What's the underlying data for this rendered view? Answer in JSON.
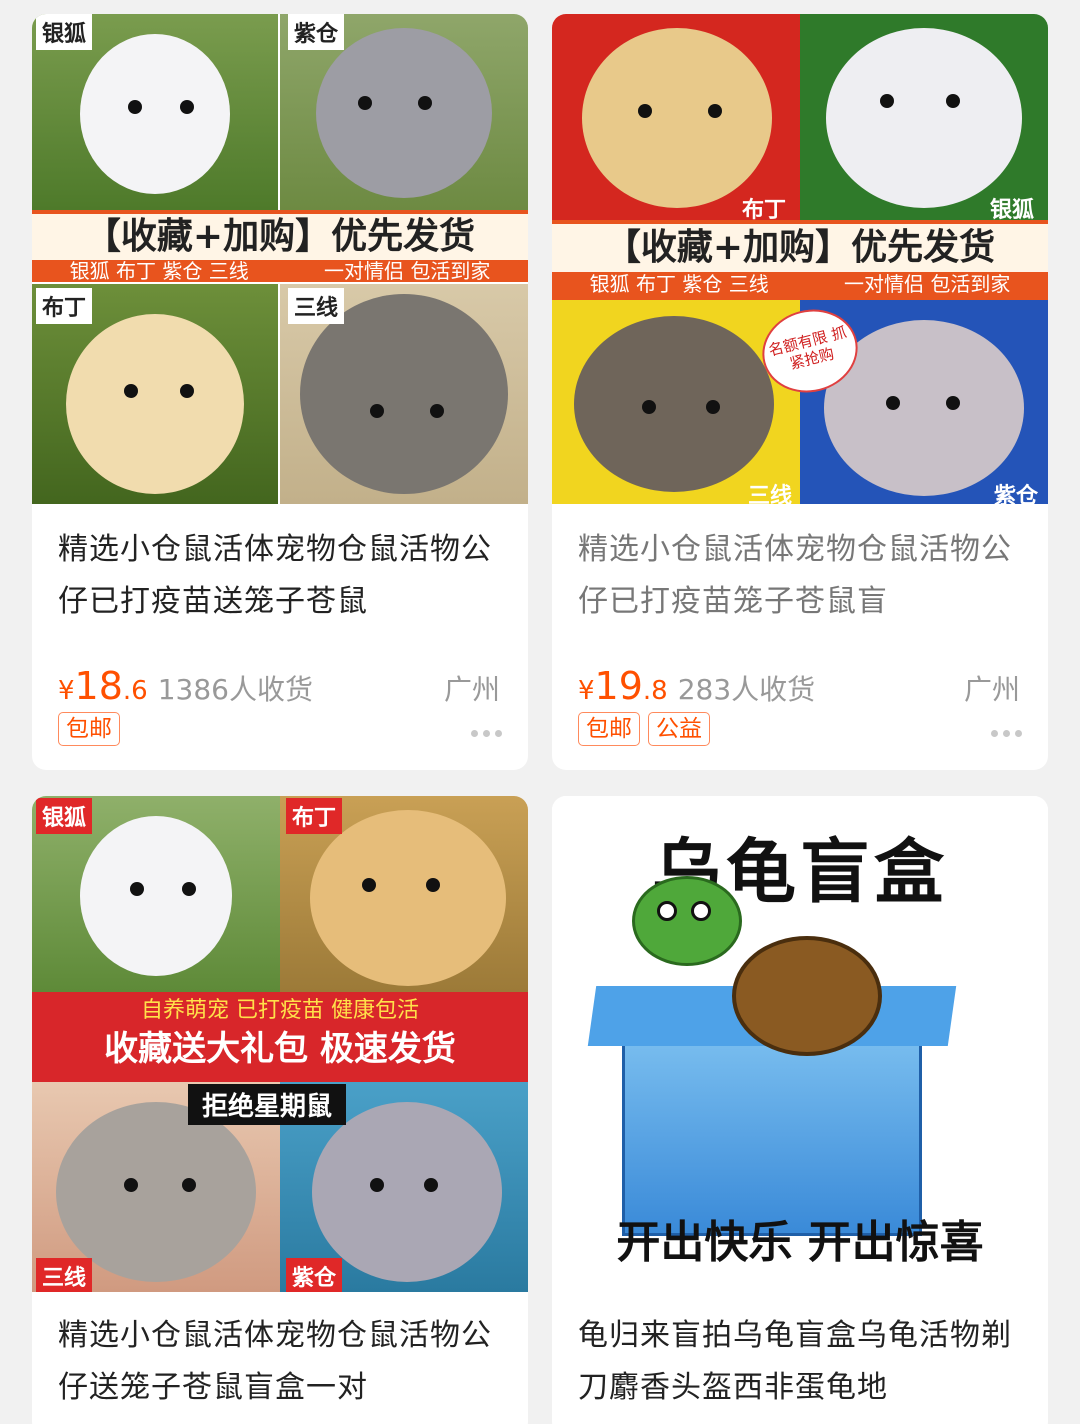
{
  "products": [
    {
      "image_labels": [
        "银狐",
        "紫仓",
        "布丁",
        "三线"
      ],
      "banner_main": "【收藏+加购】优先发货",
      "banner_sub_left": "银狐 布丁 紫仓 三线",
      "banner_sub_right": "一对情侣 包活到家",
      "title": "精选小仓鼠活体宠物仓鼠活物公仔已打疫苗送笼子苍鼠",
      "price_symbol": "¥",
      "price_int": "18",
      "price_dec": ".6",
      "sold": "1386人收货",
      "location": "广州",
      "tags": [
        "包邮"
      ]
    },
    {
      "image_labels": [
        "布丁",
        "银狐",
        "三线",
        "紫仓"
      ],
      "banner_main": "【收藏+加购】优先发货",
      "banner_sub_left": "银狐 布丁 紫仓 三线",
      "banner_sub_right": "一对情侣 包活到家",
      "sticker": "名额有限 抓紧抢购",
      "title": "精选小仓鼠活体宠物仓鼠活物公仔已打疫苗笼子苍鼠盲",
      "price_symbol": "¥",
      "price_int": "19",
      "price_dec": ".8",
      "sold": "283人收货",
      "location": "广州",
      "tags": [
        "包邮",
        "公益"
      ]
    },
    {
      "image_labels": [
        "银狐",
        "布丁",
        "三线",
        "紫仓"
      ],
      "banner_top": "自养萌宠  已打疫苗  健康包活",
      "banner_main": "收藏送大礼包 极速发货",
      "banner_black": "拒绝星期鼠",
      "title": "精选小仓鼠活体宠物仓鼠活物公仔送笼子苍鼠盲盒一对"
    },
    {
      "image_title": "乌龟盲盒",
      "image_bottom": "开出快乐    开出惊喜",
      "title": "龟归来盲拍乌龟盲盒乌龟活物剃刀麝香头盔西非蛋龟地"
    }
  ],
  "colors": {
    "price": "#ff5000",
    "banner_orange": "#e8541e",
    "banner_red": "#d8262a"
  }
}
